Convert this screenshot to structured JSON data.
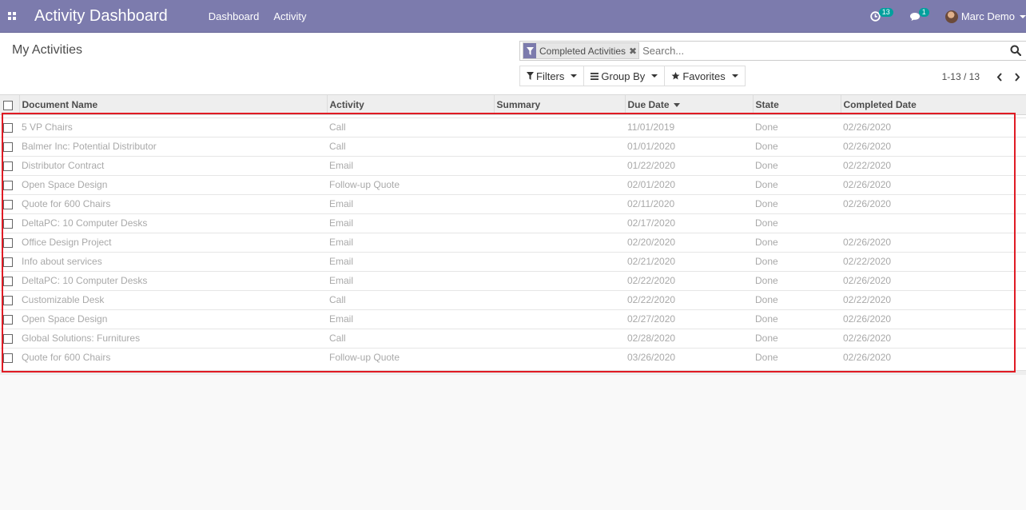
{
  "navbar": {
    "brand": "Activity Dashboard",
    "menu": [
      "Dashboard",
      "Activity"
    ],
    "activity_count": "13",
    "message_count": "1",
    "user_name": "Marc Demo",
    "bg_color": "#7c7bad"
  },
  "control_panel": {
    "title": "My Activities",
    "facet": "Completed Activities",
    "search_placeholder": "Search...",
    "filters_label": "Filters",
    "groupby_label": "Group By",
    "favorites_label": "Favorites",
    "pager": "1-13 / 13"
  },
  "table": {
    "columns": [
      "Document Name",
      "Activity",
      "Summary",
      "Due Date",
      "State",
      "Completed Date"
    ],
    "rows": [
      {
        "document": "5 VP Chairs",
        "activity": "Call",
        "summary": "",
        "due": "11/01/2019",
        "state": "Done",
        "completed": "02/26/2020"
      },
      {
        "document": "Balmer Inc: Potential Distributor",
        "activity": "Call",
        "summary": "",
        "due": "01/01/2020",
        "state": "Done",
        "completed": "02/26/2020"
      },
      {
        "document": "Distributor Contract",
        "activity": "Email",
        "summary": "",
        "due": "01/22/2020",
        "state": "Done",
        "completed": "02/22/2020"
      },
      {
        "document": "Open Space Design",
        "activity": "Follow-up Quote",
        "summary": "",
        "due": "02/01/2020",
        "state": "Done",
        "completed": "02/26/2020"
      },
      {
        "document": "Quote for 600 Chairs",
        "activity": "Email",
        "summary": "",
        "due": "02/11/2020",
        "state": "Done",
        "completed": "02/26/2020"
      },
      {
        "document": "DeltaPC: 10 Computer Desks",
        "activity": "Email",
        "summary": "",
        "due": "02/17/2020",
        "state": "Done",
        "completed": ""
      },
      {
        "document": "Office Design Project",
        "activity": "Email",
        "summary": "",
        "due": "02/20/2020",
        "state": "Done",
        "completed": "02/26/2020"
      },
      {
        "document": "Info about services",
        "activity": "Email",
        "summary": "",
        "due": "02/21/2020",
        "state": "Done",
        "completed": "02/22/2020"
      },
      {
        "document": "DeltaPC: 10 Computer Desks",
        "activity": "Email",
        "summary": "",
        "due": "02/22/2020",
        "state": "Done",
        "completed": "02/26/2020"
      },
      {
        "document": "Customizable Desk",
        "activity": "Call",
        "summary": "",
        "due": "02/22/2020",
        "state": "Done",
        "completed": "02/22/2020"
      },
      {
        "document": "Open Space Design",
        "activity": "Email",
        "summary": "",
        "due": "02/27/2020",
        "state": "Done",
        "completed": "02/26/2020"
      },
      {
        "document": "Global Solutions: Furnitures",
        "activity": "Call",
        "summary": "",
        "due": "02/28/2020",
        "state": "Done",
        "completed": "02/26/2020"
      },
      {
        "document": "Quote for 600 Chairs",
        "activity": "Follow-up Quote",
        "summary": "",
        "due": "03/26/2020",
        "state": "Done",
        "completed": "02/26/2020"
      }
    ]
  },
  "highlight_color": "#e01b24",
  "icons": {
    "apps": "apps-grid-icon",
    "clock": "clock-icon",
    "chat": "chat-icon",
    "search": "search-icon",
    "filter": "filter-icon",
    "group": "bars-icon",
    "star": "star-icon",
    "prev": "chevron-left-icon",
    "next": "chevron-right-icon"
  }
}
